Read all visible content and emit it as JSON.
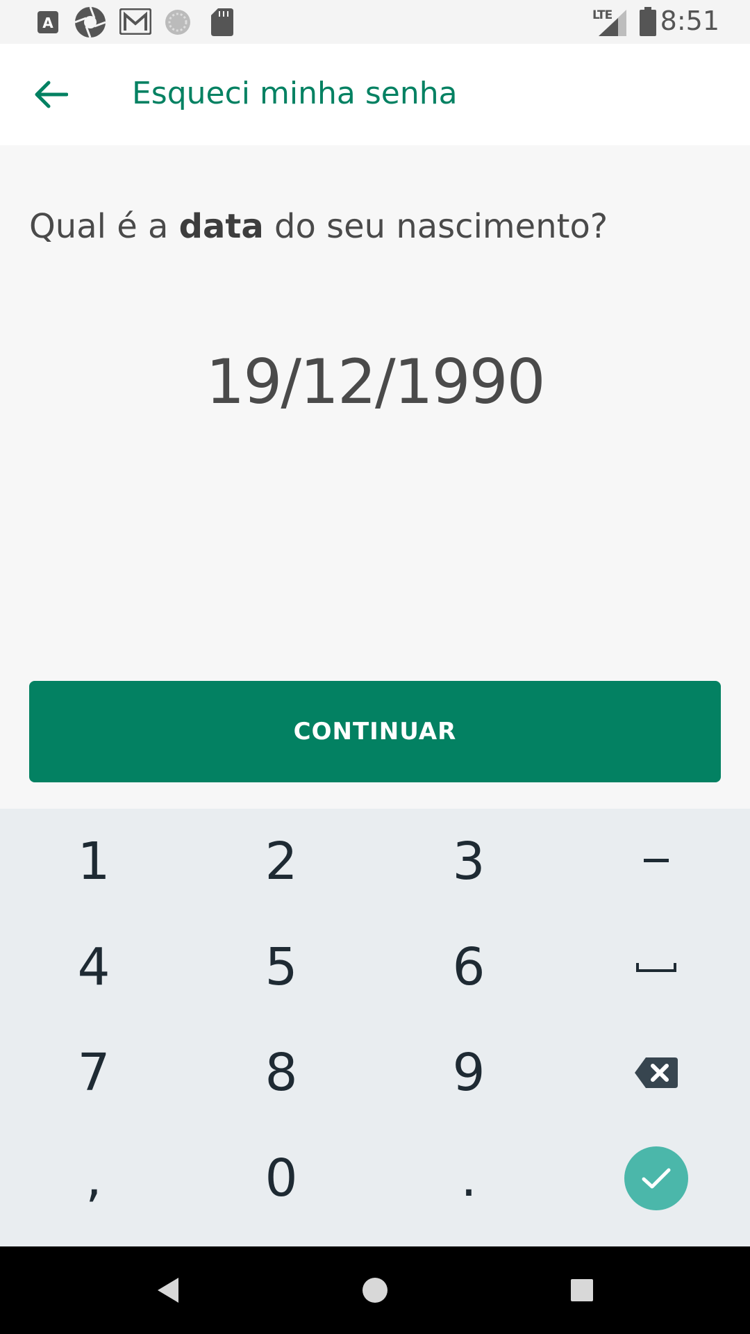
{
  "status_bar": {
    "time": "8:51",
    "network": "LTE",
    "icons": [
      "app-a-icon",
      "shutter-icon",
      "gmail-icon",
      "sync-icon",
      "sd-card-icon",
      "signal-icon",
      "battery-icon"
    ]
  },
  "app_bar": {
    "title": "Esqueci minha senha",
    "back_icon": "arrow-left-icon"
  },
  "form": {
    "question_prefix": "Qual é a ",
    "question_bold": "data",
    "question_suffix": " do seu nascimento?",
    "date_value": "19/12/1990"
  },
  "continue_button": {
    "label": "CONTINUAR"
  },
  "keypad": {
    "keys": [
      "1",
      "2",
      "3",
      "–",
      "4",
      "5",
      "6",
      "␣",
      "7",
      "8",
      "9",
      "⌫",
      ",",
      "0",
      ".",
      "✓"
    ]
  },
  "nav_bar": {
    "icons": [
      "back-triangle-icon",
      "home-circle-icon",
      "recents-square-icon"
    ]
  },
  "colors": {
    "accent": "#038162",
    "enter_key": "#4bb7aa",
    "keypad_bg": "#e9edf0"
  }
}
